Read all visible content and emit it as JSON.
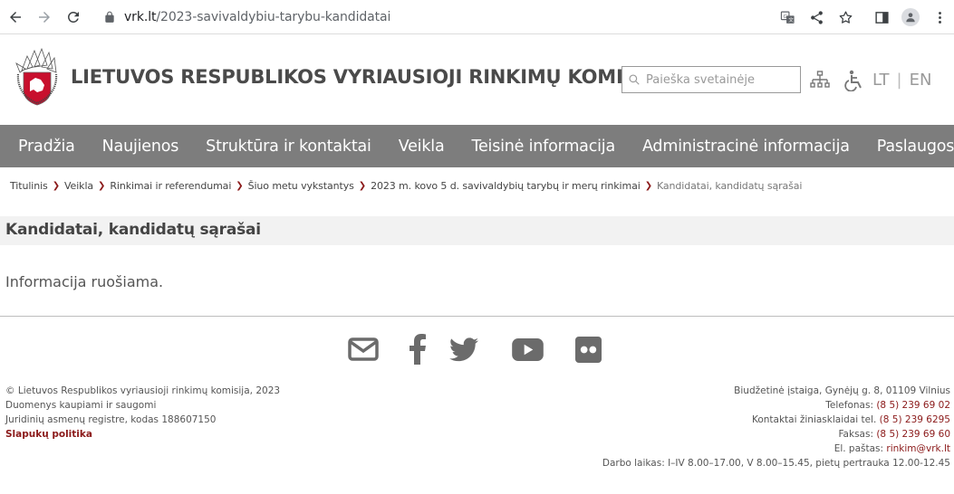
{
  "browser": {
    "url_host": "vrk.lt",
    "url_path": "/2023-savivaldybiu-tarybu-kandidatai"
  },
  "header": {
    "title": "LIETUVOS RESPUBLIKOS VYRIAUSIOJI RINKIMŲ KOMISIJA",
    "search_placeholder": "Paieška svetainėje",
    "lang_lt": "LT",
    "lang_sep": "|",
    "lang_en": "EN"
  },
  "nav": {
    "items": [
      "Pradžia",
      "Naujienos",
      "Struktūra ir kontaktai",
      "Veikla",
      "Teisinė informacija",
      "Administracinė informacija",
      "Paslaugos"
    ]
  },
  "breadcrumb": {
    "items": [
      "Titulinis",
      "Veikla",
      "Rinkimai ir referendumai",
      "Šiuo metu vykstantys",
      "2023 m. kovo 5 d. savivaldybių tarybų ir merų rinkimai",
      "Kandidatai, kandidatų sąrašai"
    ]
  },
  "page": {
    "title": "Kandidatai, kandidatų sąrašai",
    "content": "Informacija ruošiama."
  },
  "social": {
    "icons": [
      "email-icon",
      "facebook-icon",
      "twitter-icon",
      "youtube-icon",
      "flickr-icon"
    ]
  },
  "footer": {
    "left": {
      "line1": "© Lietuvos Respublikos vyriausioji rinkimų komisija, 2023",
      "line2": "Duomenys kaupiami ir saugomi",
      "line3": "Juridinių asmenų registre, kodas 188607150",
      "cookie_link": "Slapukų politika"
    },
    "right": {
      "address": "Biudžetinė įstaiga, Gynėjų g. 8, 01109 Vilnius",
      "phone_label": "Telefonas: ",
      "phone": "(8 5) 239 69 02",
      "media_label": "Kontaktai žiniasklaidai tel. ",
      "media_phone": "(8 5) 239 6295",
      "fax_label": "Faksas: ",
      "fax": "(8 5) 239 69 60",
      "email_label": "El. paštas: ",
      "email": "rinkim@vrk.lt",
      "hours": "Darbo laikas: I–IV 8.00–17.00, V 8.00–15.45, pietų pertrauka 12.00-12.45"
    }
  }
}
